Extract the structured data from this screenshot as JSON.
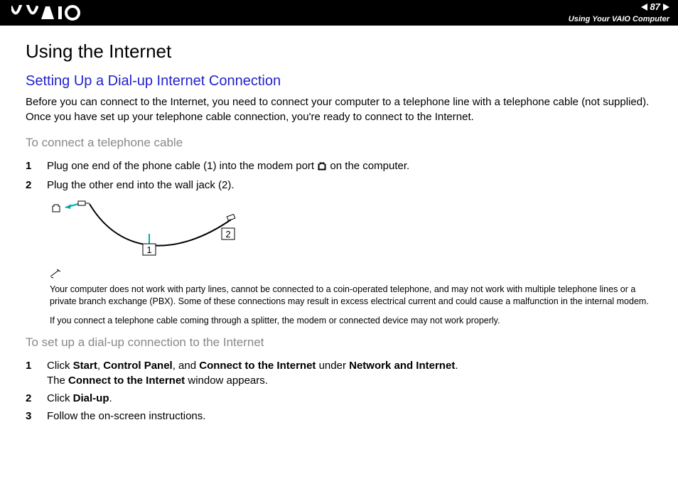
{
  "header": {
    "page_number": "87",
    "section": "Using Your VAIO Computer"
  },
  "title": "Using the Internet",
  "subtitle": "Setting Up a Dial-up Internet Connection",
  "intro": "Before you can connect to the Internet, you need to connect your computer to a telephone line with a telephone cable (not supplied). Once you have set up your telephone cable connection, you're ready to connect to the Internet.",
  "sectionA": {
    "heading": "To connect a telephone cable",
    "steps": [
      {
        "n": "1",
        "text_before": "Plug one end of the phone cable (1) into the modem port ",
        "text_after": " on the computer."
      },
      {
        "n": "2",
        "text_before": "Plug the other end into the wall jack (2).",
        "text_after": ""
      }
    ]
  },
  "diagram": {
    "label1": "1",
    "label2": "2"
  },
  "note": {
    "p1": "Your computer does not work with party lines, cannot be connected to a coin-operated telephone, and may not work with multiple telephone lines or a private branch exchange (PBX). Some of these connections may result in excess electrical current and could cause a malfunction in the internal modem.",
    "p2": "If you connect a telephone cable coming through a splitter, the modem or connected device may not work properly."
  },
  "sectionB": {
    "heading": "To set up a dial-up connection to the Internet",
    "steps": [
      {
        "n": "1",
        "html": "Click <b>Start</b>, <b>Control Panel</b>, and <b>Connect to the Internet</b> under <b>Network and Internet</b>.<br>The <b>Connect to the Internet</b> window appears."
      },
      {
        "n": "2",
        "html": "Click <b>Dial-up</b>."
      },
      {
        "n": "3",
        "html": "Follow the on-screen instructions."
      }
    ]
  }
}
